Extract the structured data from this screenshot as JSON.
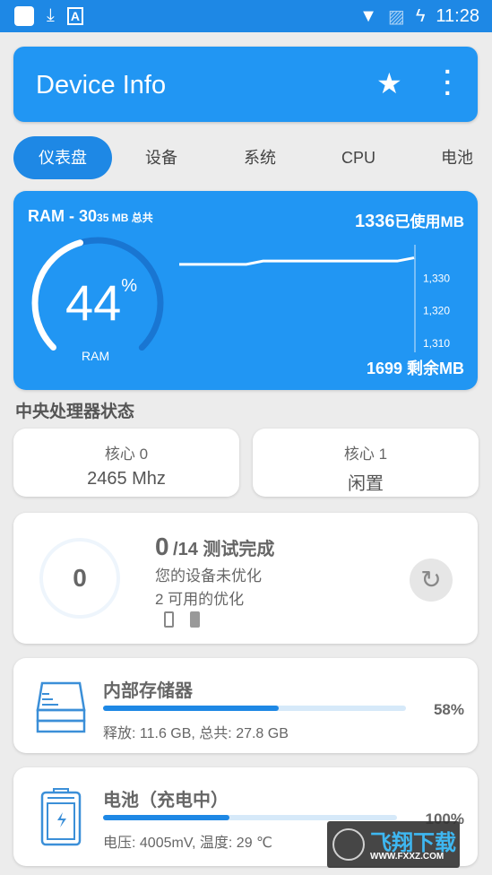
{
  "status_bar": {
    "time": "11:28",
    "icons": [
      "app-icon",
      "download-icon",
      "text-icon",
      "wifi-icon",
      "no-sim-icon",
      "battery-charging-icon"
    ]
  },
  "app_bar": {
    "title": "Device Info",
    "icons": [
      "star-icon",
      "more-vert-icon"
    ]
  },
  "tabs": [
    {
      "label": "仪表盘",
      "active": true
    },
    {
      "label": "设备"
    },
    {
      "label": "系统"
    },
    {
      "label": "CPU"
    },
    {
      "label": "电池"
    }
  ],
  "ram": {
    "title_prefix": "RAM - 30",
    "title_small": "35 MB 总共",
    "percent": "44",
    "percent_sign": "%",
    "gauge_label": "RAM",
    "used": "1336",
    "used_unit": "已使用MB",
    "free": "1699",
    "free_unit": "剩余MB",
    "accent": "#2196f3"
  },
  "chart_data": {
    "type": "line",
    "values": [
      1334,
      1334,
      1334,
      1334,
      1334,
      1335,
      1335,
      1335,
      1335,
      1335,
      1335,
      1335,
      1335,
      1335,
      1336
    ],
    "y_ticks": [
      "1,330",
      "1,320",
      "1,310"
    ],
    "ylim": [
      1307,
      1340
    ],
    "grid": false
  },
  "cpu": {
    "title": "中央处理器状态",
    "cores": [
      {
        "label": "核心 0",
        "value": "2465 Mhz"
      },
      {
        "label": "核心 1",
        "value": "闲置"
      }
    ]
  },
  "tests": {
    "score": "0",
    "done": "0",
    "total": "/14 测试完成",
    "line1": "您的设备未优化",
    "line2": "2 可用的优化",
    "icons": [
      "phone-icon",
      "phone-lock-icon",
      "refresh-icon"
    ]
  },
  "storage": {
    "title": "内部存储器",
    "percent": "58%",
    "fill": 58,
    "detail": "释放: 11.6 GB,  总共: 27.8 GB"
  },
  "battery": {
    "title": "电池（充电中）",
    "percent": "100%",
    "fill": 43,
    "detail": "电压: 4005mV,  温度: 29 ℃"
  },
  "watermark": {
    "text": "飞翔下载",
    "url": "WWW.FXXZ.COM"
  }
}
